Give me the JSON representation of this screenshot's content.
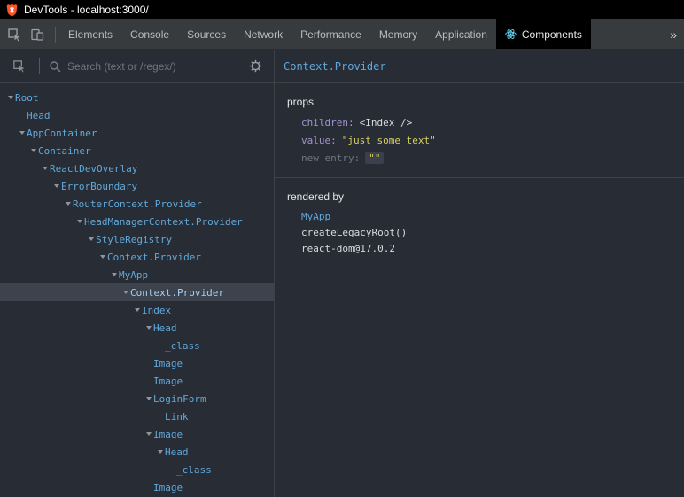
{
  "window": {
    "title": "DevTools - localhost:3000/"
  },
  "tabs": {
    "items": [
      "Elements",
      "Console",
      "Sources",
      "Network",
      "Performance",
      "Memory",
      "Application",
      "Components"
    ],
    "active": "Components",
    "overflow": "»"
  },
  "toolbar": {
    "search_placeholder": "Search (text or /regex/)"
  },
  "tree": {
    "rows": [
      {
        "label": "Root",
        "depth": 0,
        "expanded": true
      },
      {
        "label": "Head",
        "depth": 1,
        "expanded": false
      },
      {
        "label": "AppContainer",
        "depth": 1,
        "expanded": true
      },
      {
        "label": "Container",
        "depth": 2,
        "expanded": true
      },
      {
        "label": "ReactDevOverlay",
        "depth": 3,
        "expanded": true
      },
      {
        "label": "ErrorBoundary",
        "depth": 4,
        "expanded": true
      },
      {
        "label": "RouterContext.Provider",
        "depth": 5,
        "expanded": true
      },
      {
        "label": "HeadManagerContext.Provider",
        "depth": 6,
        "expanded": true
      },
      {
        "label": "StyleRegistry",
        "depth": 7,
        "expanded": true
      },
      {
        "label": "Context.Provider",
        "depth": 8,
        "expanded": true
      },
      {
        "label": "MyApp",
        "depth": 9,
        "expanded": true
      },
      {
        "label": "Context.Provider",
        "depth": 10,
        "expanded": true,
        "selected": true
      },
      {
        "label": "Index",
        "depth": 11,
        "expanded": true
      },
      {
        "label": "Head",
        "depth": 12,
        "expanded": true
      },
      {
        "label": "_class",
        "depth": 13,
        "expanded": false
      },
      {
        "label": "Image",
        "depth": 12,
        "expanded": false
      },
      {
        "label": "Image",
        "depth": 12,
        "expanded": false
      },
      {
        "label": "LoginForm",
        "depth": 12,
        "expanded": true
      },
      {
        "label": "Link",
        "depth": 13,
        "expanded": false
      },
      {
        "label": "Image",
        "depth": 12,
        "expanded": true
      },
      {
        "label": "Head",
        "depth": 13,
        "expanded": true
      },
      {
        "label": "_class",
        "depth": 14,
        "expanded": false
      },
      {
        "label": "Image",
        "depth": 12,
        "expanded": false
      }
    ]
  },
  "details": {
    "title": "Context.Provider",
    "props": {
      "heading": "props",
      "rows": [
        {
          "key": "children",
          "value": "<Index />",
          "type": "element"
        },
        {
          "key": "value",
          "value": "\"just some text\"",
          "type": "string"
        },
        {
          "key": "new entry",
          "value": "\"\"",
          "type": "new"
        }
      ]
    },
    "rendered_by": {
      "heading": "rendered by",
      "items": [
        {
          "label": "MyApp",
          "type": "link"
        },
        {
          "label": "createLegacyRoot()",
          "type": "text"
        },
        {
          "label": "react-dom@17.0.2",
          "type": "text"
        }
      ]
    }
  },
  "colors": {
    "component_name": "#61a9dc",
    "string_value": "#d8d05f",
    "attribute_name": "#a393cf",
    "selected_row_bg": "#3d434d",
    "react_logo": "#61dafb",
    "brave_shield": "#fb542b"
  }
}
